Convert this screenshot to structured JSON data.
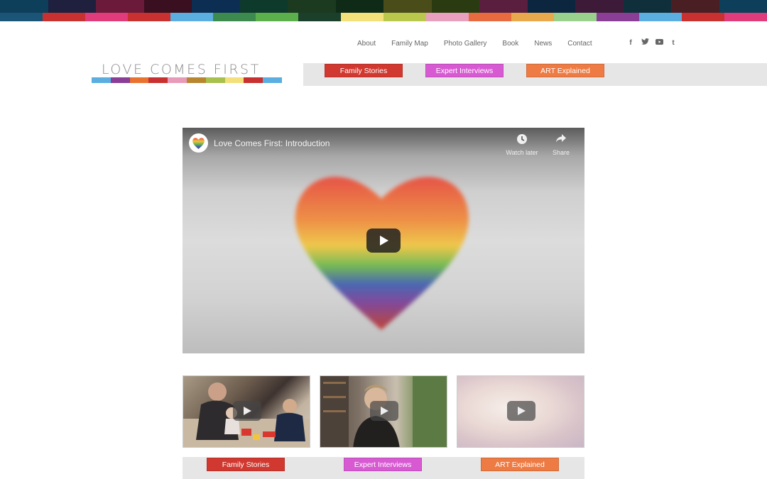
{
  "nav": {
    "links": [
      "About",
      "Family Map",
      "Photo Gallery",
      "Book",
      "News",
      "Contact"
    ],
    "social_icons": [
      "facebook-icon",
      "twitter-icon",
      "youtube-icon",
      "tumblr-icon"
    ],
    "social_glyphs": [
      "f",
      "t",
      "▶",
      "t"
    ]
  },
  "logo": {
    "text": "LOVE COMES FIRST",
    "bar_colors": [
      "#5aaee0",
      "#8a3e96",
      "#e8722f",
      "#c8312f",
      "#e89ab9",
      "#b8862f",
      "#a8c04c",
      "#f3e07a",
      "#c8312f",
      "#5aaee0"
    ]
  },
  "top_stripe": {
    "dark_colors": [
      "#0d3e5a",
      "#1f1f3e",
      "#6b1a3a",
      "#3a0f1f",
      "#0d2e53",
      "#0e3a2c",
      "#1b3a1f",
      "#0f2b18",
      "#4a4d1a",
      "#2a3b12",
      "#5a1f3e",
      "#0c2640",
      "#3d1a38",
      "#0f2f3b",
      "#4a1f24",
      "#0d3e5a"
    ],
    "light_colors": [
      "#1a5577",
      "#c8312f",
      "#e03b7b",
      "#c8312f",
      "#5aaee0",
      "#3c8a4e",
      "#5bb04c",
      "#1a3f2a",
      "#f3e07a",
      "#b9c84c",
      "#e8a0be",
      "#e86a3f",
      "#e8a84c",
      "#98d08c",
      "#8a3e96",
      "#5aaee0",
      "#c8312f",
      "#e03b7b"
    ]
  },
  "categories": {
    "top": [
      {
        "label": "Family Stories",
        "color": "#d1382f"
      },
      {
        "label": "Expert Interviews",
        "color": "#d85ad3"
      },
      {
        "label": "ART Explained",
        "color": "#ee7b43"
      }
    ],
    "bottom": [
      {
        "label": "Family Stories",
        "color": "#d1382f"
      },
      {
        "label": "Expert Interviews",
        "color": "#d85ad3"
      },
      {
        "label": "ART Explained",
        "color": "#ee7b43"
      }
    ]
  },
  "video": {
    "title": "Love Comes First: Introduction",
    "watch_later": "Watch later",
    "share": "Share",
    "heart_colors": [
      "#e94b3c",
      "#f08a3a",
      "#f1c640",
      "#6cb84a",
      "#3f5fb0",
      "#7a3f96",
      "#c0392b"
    ]
  },
  "thumbnails": [
    {
      "name": "family-stories-thumbnail"
    },
    {
      "name": "expert-interviews-thumbnail"
    },
    {
      "name": "art-explained-thumbnail"
    }
  ]
}
